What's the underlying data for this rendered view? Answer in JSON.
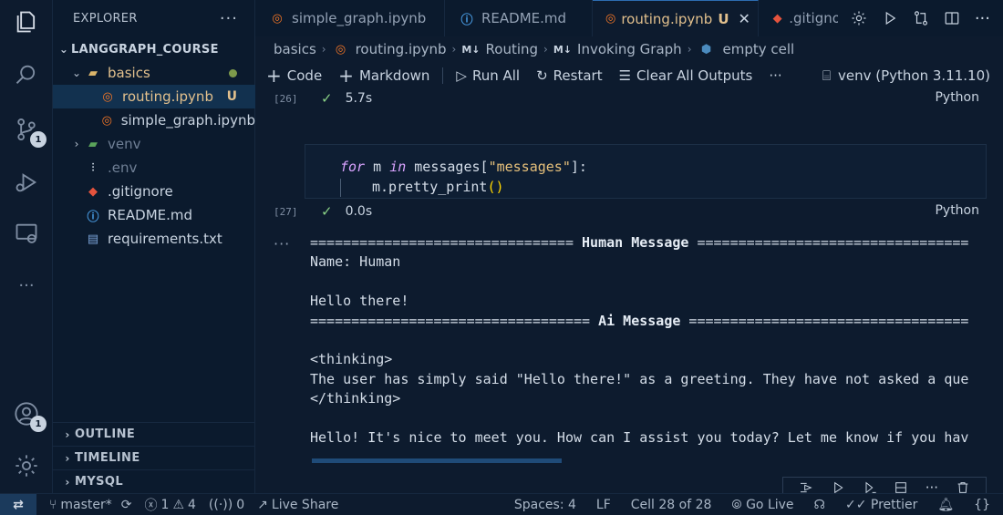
{
  "sidebar": {
    "title": "EXPLORER",
    "more": "···",
    "tree": [
      {
        "label": "LANGGRAPH_COURSE"
      },
      {
        "label": "basics"
      },
      {
        "label": "routing.ipynb",
        "git": "U"
      },
      {
        "label": "simple_graph.ipynb"
      },
      {
        "label": "venv"
      },
      {
        "label": ".env"
      },
      {
        "label": ".gitignore"
      },
      {
        "label": "README.md"
      },
      {
        "label": "requirements.txt"
      }
    ],
    "sections": [
      "OUTLINE",
      "TIMELINE",
      "MYSQL"
    ]
  },
  "activity": {
    "scm_badge": "1",
    "accounts_badge": "1",
    "more": "···"
  },
  "tabs": [
    {
      "label": "simple_graph.ipynb"
    },
    {
      "label": "README.md"
    },
    {
      "label": "routing.ipynb",
      "git": "U",
      "close": "✕"
    },
    {
      "label": ".gitignore"
    }
  ],
  "breadcrumb": {
    "folder": "basics",
    "file": "routing.ipynb",
    "h1_tag": "M↓",
    "h1": "Routing",
    "h2_tag": "M↓",
    "h2": "Invoking Graph",
    "cell": "empty cell"
  },
  "toolbar": {
    "code": "Code",
    "markdown": "Markdown",
    "run_all": "Run All",
    "restart": "Restart",
    "clear": "Clear All Outputs",
    "more": "···",
    "kernel": "venv (Python 3.11.10)"
  },
  "cells": {
    "prev_count": "[26]",
    "prev_time": "5.7s",
    "prev_lang": "Python",
    "code_line1_kw": "for",
    "code_line1_a": " m ",
    "code_line1_kw2": "in",
    "code_line1_b": " messages[",
    "code_line1_str": "\"messages\"",
    "code_line1_c": "]:",
    "code_line2": "m.pretty_print",
    "code_line2_paren": "()",
    "count": "[27]",
    "time": "0.0s",
    "lang": "Python",
    "out_dots": "···"
  },
  "output": {
    "sep1_left": "================================ ",
    "human_header": "Human Message",
    "sep1_right": " =================================",
    "name_line": "Name: Human",
    "hello": "Hello there!",
    "sep2_left": "================================== ",
    "ai_header": "Ai Message",
    "sep2_right": " ==================================",
    "think_open": "<thinking>",
    "think_body": "The user has simply said \"Hello there!\" as a greeting. They have not asked a que",
    "think_close": "</thinking>",
    "reply": "Hello! It's nice to meet you. How can I assist you today? Let me know if you hav"
  },
  "statusbar": {
    "remote": "⇄",
    "branch": "master*",
    "errors": "1",
    "warnings": "4",
    "ports": "0",
    "live_share": "Live Share",
    "spaces": "Spaces: 4",
    "eol": "LF",
    "cell": "Cell 28 of 28",
    "go_live": "Go Live",
    "prettier": "Prettier",
    "braces": "{}"
  }
}
